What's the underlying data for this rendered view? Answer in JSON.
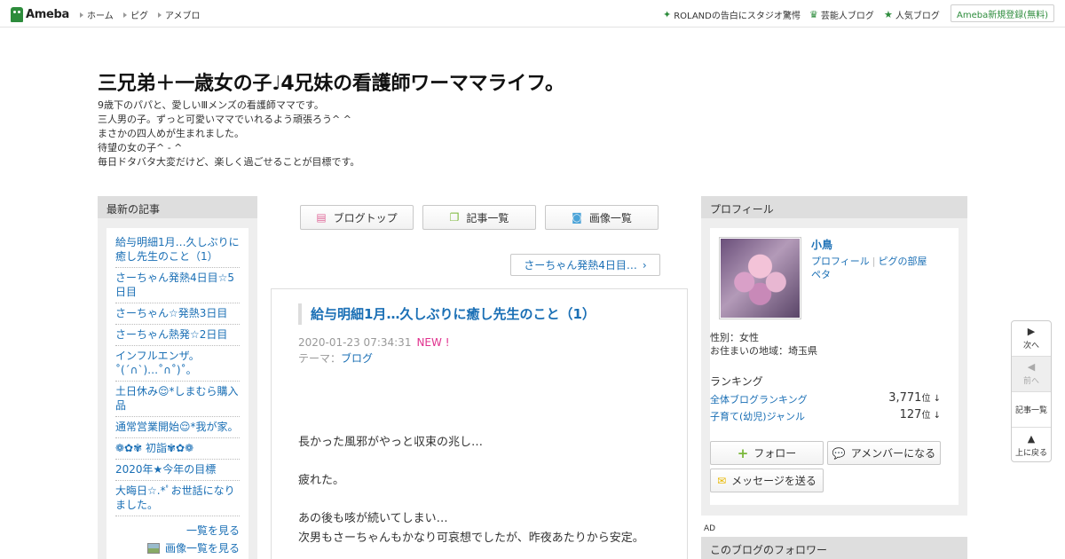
{
  "topbar": {
    "logo_text": "Ameba",
    "nav": [
      "ホーム",
      "ピグ",
      "アメブロ"
    ],
    "links": [
      {
        "label": "ROLANDの告白にスタジオ驚愕",
        "icon": "sparkle-icon"
      },
      {
        "label": "芸能人ブログ",
        "icon": "crown-icon"
      },
      {
        "label": "人気ブログ",
        "icon": "star-icon"
      }
    ],
    "signup_label": "Ameba新規登録(無料)"
  },
  "header": {
    "title": "三兄弟＋一歳女の子♩4兄妹の看護師ワーママライフ。",
    "description": [
      "9歳下のパパと、愛しいⅢメンズの看護師ママです。",
      "三人男の子。ずっと可愛いママでいれるよう頑張ろう^ ^",
      "まさかの四人めが生まれました。",
      "待望の女の子^ - ^",
      "毎日ドタバタ大変だけど、楽しく過ごせることが目標です。"
    ]
  },
  "left": {
    "heading": "最新の記事",
    "items": [
      "給与明細1月…久しぶりに癒し先生のこと（1）",
      "さーちゃん発熱4日目☆5日目",
      "さーちゃん☆発熱3日目",
      "さーちゃん熱発☆2日目",
      "インフルエンザ。˚(ˊ∩ˋ)…˚∩˚)˚。",
      "土日休み😌*しまむら購入品",
      "通常営業開始😌*我が家。",
      "❁✿✾ 初詣✾✿❁",
      "2020年★今年の目標",
      "大晦日☆.*ﾟお世話になりました。"
    ],
    "more_label": "一覧を見る",
    "images_label": "画像一覧を見る"
  },
  "center": {
    "buttons": [
      {
        "label": "ブログトップ",
        "icon": "document-icon",
        "color": "#e06a9a"
      },
      {
        "label": "記事一覧",
        "icon": "copy-icon",
        "color": "#7ab83a"
      },
      {
        "label": "画像一覧",
        "icon": "camera-icon",
        "color": "#4aa3d8"
      }
    ],
    "next_article": "さーちゃん発熱4日目…"
  },
  "article": {
    "title": "給与明細1月…久しぶりに癒し先生のこと（1）",
    "date": "2020-01-23 07:34:31",
    "new_badge": "NEW !",
    "theme_label": "テーマ：",
    "theme": "ブログ",
    "paragraphs": [
      "長かった風邪がやっと収束の兆し…",
      "",
      "疲れた。",
      "",
      "あの後も咳が続いてしまい…",
      "次男もさーちゃんもかなり可哀想でしたが、昨夜あたりから安定。"
    ]
  },
  "right": {
    "heading": "プロフィール",
    "name": "小鳥",
    "links": [
      "プロフィール",
      "ピグの部屋",
      "ペタ"
    ],
    "gender": "性別：女性",
    "location": "お住まいの地域：埼玉県",
    "ranking_heading": "ランキング",
    "rankings": [
      {
        "label": "全体ブログランキング",
        "value": "3,771",
        "unit": "位 ↓"
      },
      {
        "label": "子育て(幼児)ジャンル",
        "value": "127",
        "unit": "位 ↓"
      }
    ],
    "follow_label": "フォロー",
    "amember_label": "アメンバーになる",
    "message_label": "メッセージを送る",
    "ad_label": "AD",
    "followers_heading": "このブログのフォロワー",
    "colors": {
      "follow": "#7ab83a",
      "amember": "#4aa3d8",
      "message": "#e8b800"
    }
  },
  "float_nav": {
    "next": "次へ",
    "prev": "前へ",
    "list": "記事一覧",
    "top": "上に戻る"
  }
}
